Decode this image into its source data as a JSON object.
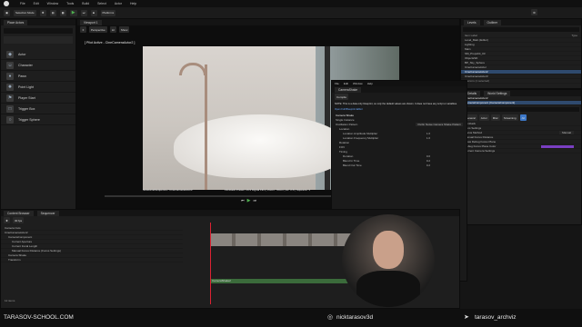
{
  "menu": [
    "File",
    "Edit",
    "Window",
    "Tools",
    "Build",
    "Select",
    "Actor",
    "Help"
  ],
  "level_tab": "Level_Main",
  "toolbar": {
    "selection_mode": "Selection Mode",
    "platforms": "Platforms"
  },
  "place_actors": {
    "tab": "Place Actors",
    "items": [
      "Actor",
      "Character",
      "Pawn",
      "Point Light",
      "Player Start",
      "Trigger Box",
      "Trigger Sphere"
    ]
  },
  "viewport": {
    "tab": "Viewport 1",
    "perspective": "Perspective",
    "lit": "Lit",
    "show": "Show",
    "pilot_label": "[ Pilot Active - CineCameraActor2 ]",
    "sequence_label": "NewLevelSequence / CineCameraActor2",
    "filmback_label": "Filmback Preset: 16:9 Digital Film | Zoom: 78mm | Av: 2.8 | Squeeze: 1"
  },
  "outliner": {
    "tab": "Levels",
    "tab2": "Outliner",
    "header_label": "Item Label",
    "header_type": "Type",
    "rows": [
      "Level_Main (Editor)",
      "Lighting",
      "Main",
      "SM_PropsKit_03",
      "ObjectsSD",
      "BP_Sky_Sphere",
      "CineCameraActor",
      "CineCameraActor2",
      "CineCameraActor3"
    ],
    "count": "3 actors (1 selected)"
  },
  "details": {
    "tab": "Details",
    "tab2": "World Settings",
    "object": "CineCameraActor2",
    "component": "CameraComponent (CameraComponent)",
    "filters": [
      "General",
      "Actor",
      "Misc",
      "Streaming",
      "All"
    ],
    "rows": [
      "Filmback",
      "Lens Settings",
      "Focus Method",
      "Manual Focus Distance",
      "Draw Debug Focus Plane",
      "Debug Focus Plane Color",
      "Current Camera Settings"
    ],
    "focus_method": "Manual"
  },
  "bp_editor": {
    "title": "CameraShake",
    "note": "NOTE: This is a data only blueprint, so only the default values are shown. It does not have any script or variables.",
    "link": "Open Full Blueprint Editor",
    "compile": "Compile",
    "rows": [
      "Camera Shake",
      "Single Instance",
      "Oscillation Pattern",
      "Location",
      "Location Amplitude Multiplier",
      "Location Frequency Multiplier",
      "Rotation",
      "FOV",
      "Timing",
      "Duration",
      "Blend In Time",
      "Blend Out Time"
    ],
    "pattern": "Perlin Noise Camera Shake Pattern",
    "values": [
      "1.0",
      "1.0",
      "0.0",
      "0.2",
      "0.2"
    ]
  },
  "sequencer": {
    "tab": "Sequencer",
    "tab2": "Content Browser",
    "fps": "30 fps",
    "tracks": [
      "Camera Cuts",
      "CineCameraActor2",
      "CameraComponent",
      "Current Aperture",
      "Current Focal Length",
      "Manual Focus Distance (Focus Settings)",
      "Camera Shake",
      "Transform"
    ],
    "clip": "CameraShake2",
    "items": "12 items"
  },
  "status": {
    "console": "Cmd",
    "derived": "Derived Data",
    "source": "Source Control"
  },
  "watermarks": {
    "school": "TARASOV-SCHOOL.COM",
    "instagram": "nicktarasov3d",
    "telegram": "tarasov_archviz"
  },
  "colors": {
    "accent": "#2f4a6e",
    "selected": "#3d78c8",
    "play": "#4fb04f",
    "purple": "#7a3fc2",
    "track_green": "#3b6b3b"
  }
}
